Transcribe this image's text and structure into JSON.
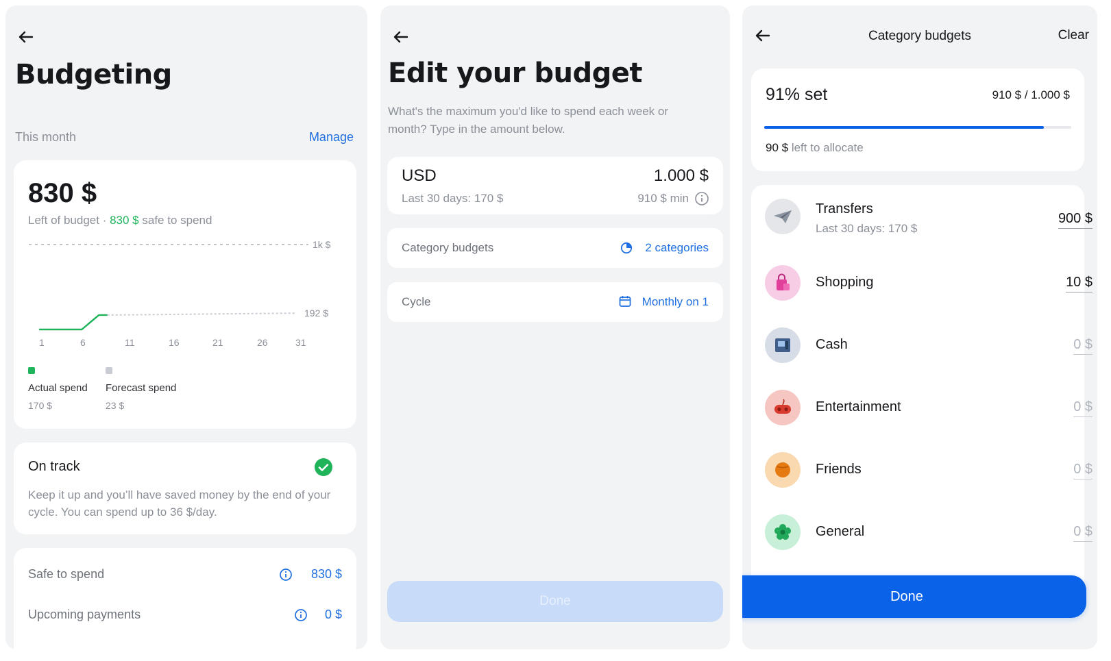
{
  "budgeting": {
    "title": "Budgeting",
    "period_label": "This month",
    "manage_label": "Manage",
    "amount": "830 $",
    "left_prefix": "Left of budget · ",
    "safe_amount": "830 $",
    "safe_suffix": " safe to spend",
    "chart_data": {
      "type": "line",
      "x_ticks": [
        "1",
        "6",
        "11",
        "16",
        "21",
        "26",
        "31"
      ],
      "reference_lines": [
        {
          "label": "1k $",
          "value": 1000
        },
        {
          "label": "192 $",
          "value": 192
        }
      ],
      "series": [
        {
          "name": "Actual spend",
          "color": "#1fb35a",
          "x": [
            1,
            6,
            8,
            9
          ],
          "y": [
            0,
            0,
            170,
            170
          ]
        },
        {
          "name": "Forecast spend",
          "color": "#c9cdd3",
          "x": [
            9,
            31
          ],
          "y": [
            170,
            192
          ]
        }
      ]
    },
    "legend": [
      {
        "name": "Actual spend",
        "value": "170 $",
        "color": "#1fb35a"
      },
      {
        "name": "Forecast spend",
        "value": "23 $",
        "color": "#c9cdd3"
      }
    ],
    "status_title": "On track",
    "status_text": "Keep it up and you’ll have saved money by the end of your cycle. You can spend up to 36 $/day.",
    "safe_to_spend_label": "Safe to spend",
    "safe_to_spend_value": "830 $",
    "upcoming_label": "Upcoming payments",
    "upcoming_value": "0 $"
  },
  "edit": {
    "title": "Edit your budget",
    "subtitle_line1": "What's the maximum you'd like to spend each week or",
    "subtitle_line2": "month? Type in the amount below.",
    "currency": "USD",
    "amount": "1.000 $",
    "last30": "Last 30 days: 170 $",
    "min": "910 $ min",
    "category_label": "Category budgets",
    "category_value": "2 categories",
    "cycle_label": "Cycle",
    "cycle_value": "Monthly on 1",
    "done_label": "Done"
  },
  "categories": {
    "title": "Category budgets",
    "clear_label": "Clear",
    "percent_set": "91% set",
    "allocated": "910 $ / 1.000 $",
    "progress": 0.91,
    "left_amount": "90 $",
    "left_suffix": " left to allocate",
    "items": [
      {
        "name": "Transfers",
        "sub": "Last 30 days: 170 $",
        "amount": "900 $"
      },
      {
        "name": "Shopping",
        "amount": "10 $"
      },
      {
        "name": "Cash",
        "amount": "0 $"
      },
      {
        "name": "Entertainment",
        "amount": "0 $"
      },
      {
        "name": "Friends",
        "amount": "0 $"
      },
      {
        "name": "General",
        "amount": "0 $"
      }
    ],
    "done_label": "Done"
  },
  "colors": {
    "accent": "#1f6fe0",
    "primary_button": "#0a62e8",
    "success": "#1fb35a",
    "panel_bg": "#f2f3f5"
  }
}
